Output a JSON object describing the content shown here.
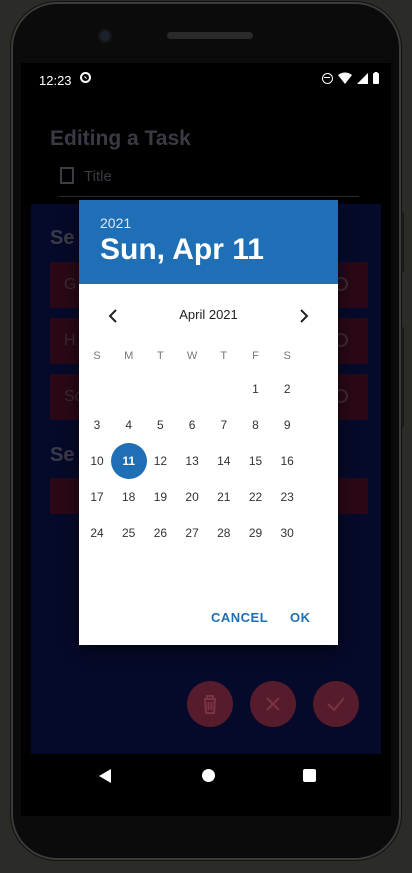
{
  "status_bar": {
    "time": "12:23"
  },
  "app": {
    "title": "Editing a Task",
    "title_placeholder": "Title",
    "section1_heading": "Se",
    "options": [
      "G",
      "H",
      "Sc"
    ],
    "section2_heading": "Se"
  },
  "dialog": {
    "year": "2021",
    "selected_date": "Sun, Apr 11",
    "month_label": "April 2021",
    "weekdays": [
      "S",
      "M",
      "T",
      "W",
      "T",
      "F",
      "S"
    ],
    "days": [
      "1",
      "2",
      "3",
      "4",
      "5",
      "6",
      "7",
      "8",
      "9",
      "10",
      "11",
      "12",
      "13",
      "14",
      "15",
      "16",
      "17",
      "18",
      "19",
      "20",
      "21",
      "22",
      "23",
      "24",
      "25",
      "26",
      "27",
      "28",
      "29",
      "30"
    ],
    "first_weekday_index": 4,
    "selected_day": "11",
    "cancel_label": "CANCEL",
    "ok_label": "OK"
  },
  "colors": {
    "accent": "#1e6fb5",
    "fab": "#561c2b"
  }
}
